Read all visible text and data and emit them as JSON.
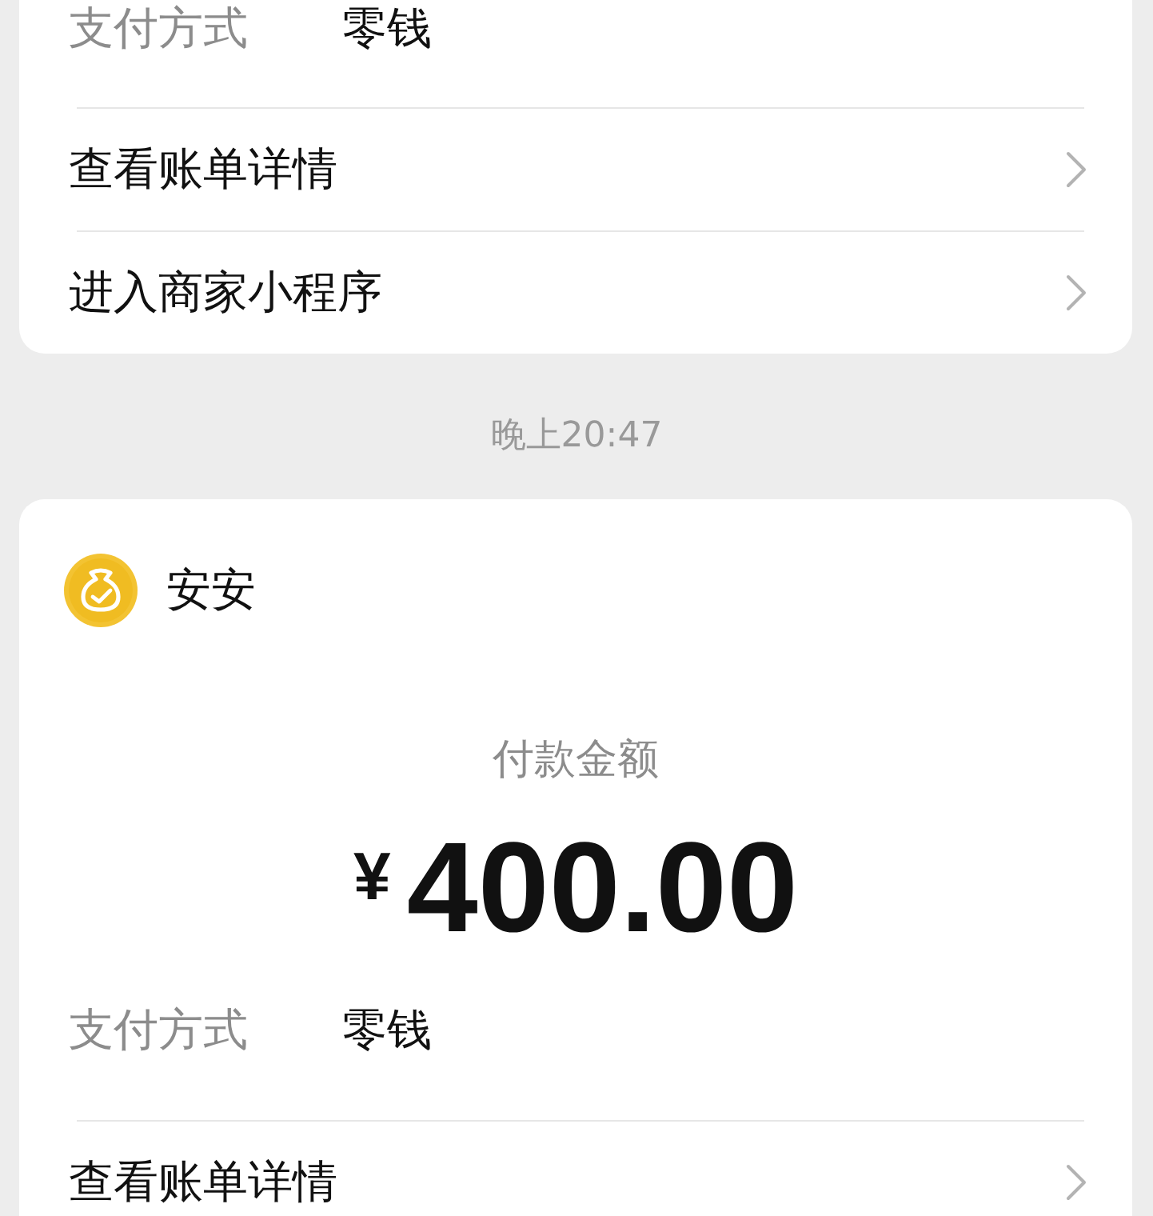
{
  "messages": [
    {
      "kind": "payment_card",
      "payment_method": {
        "label": "支付方式",
        "value": "零钱"
      },
      "actions": [
        {
          "label": "查看账单详情"
        },
        {
          "label": "进入商家小程序"
        }
      ]
    },
    {
      "kind": "timestamp",
      "text": "晚上20:47"
    },
    {
      "kind": "payment_card",
      "merchant": {
        "name": "安安"
      },
      "amount_label": "付款金额",
      "amount": {
        "currency": "¥",
        "value": "400.00"
      },
      "payment_method": {
        "label": "支付方式",
        "value": "零钱"
      },
      "actions": [
        {
          "label": "查看账单详情"
        }
      ]
    }
  ]
}
